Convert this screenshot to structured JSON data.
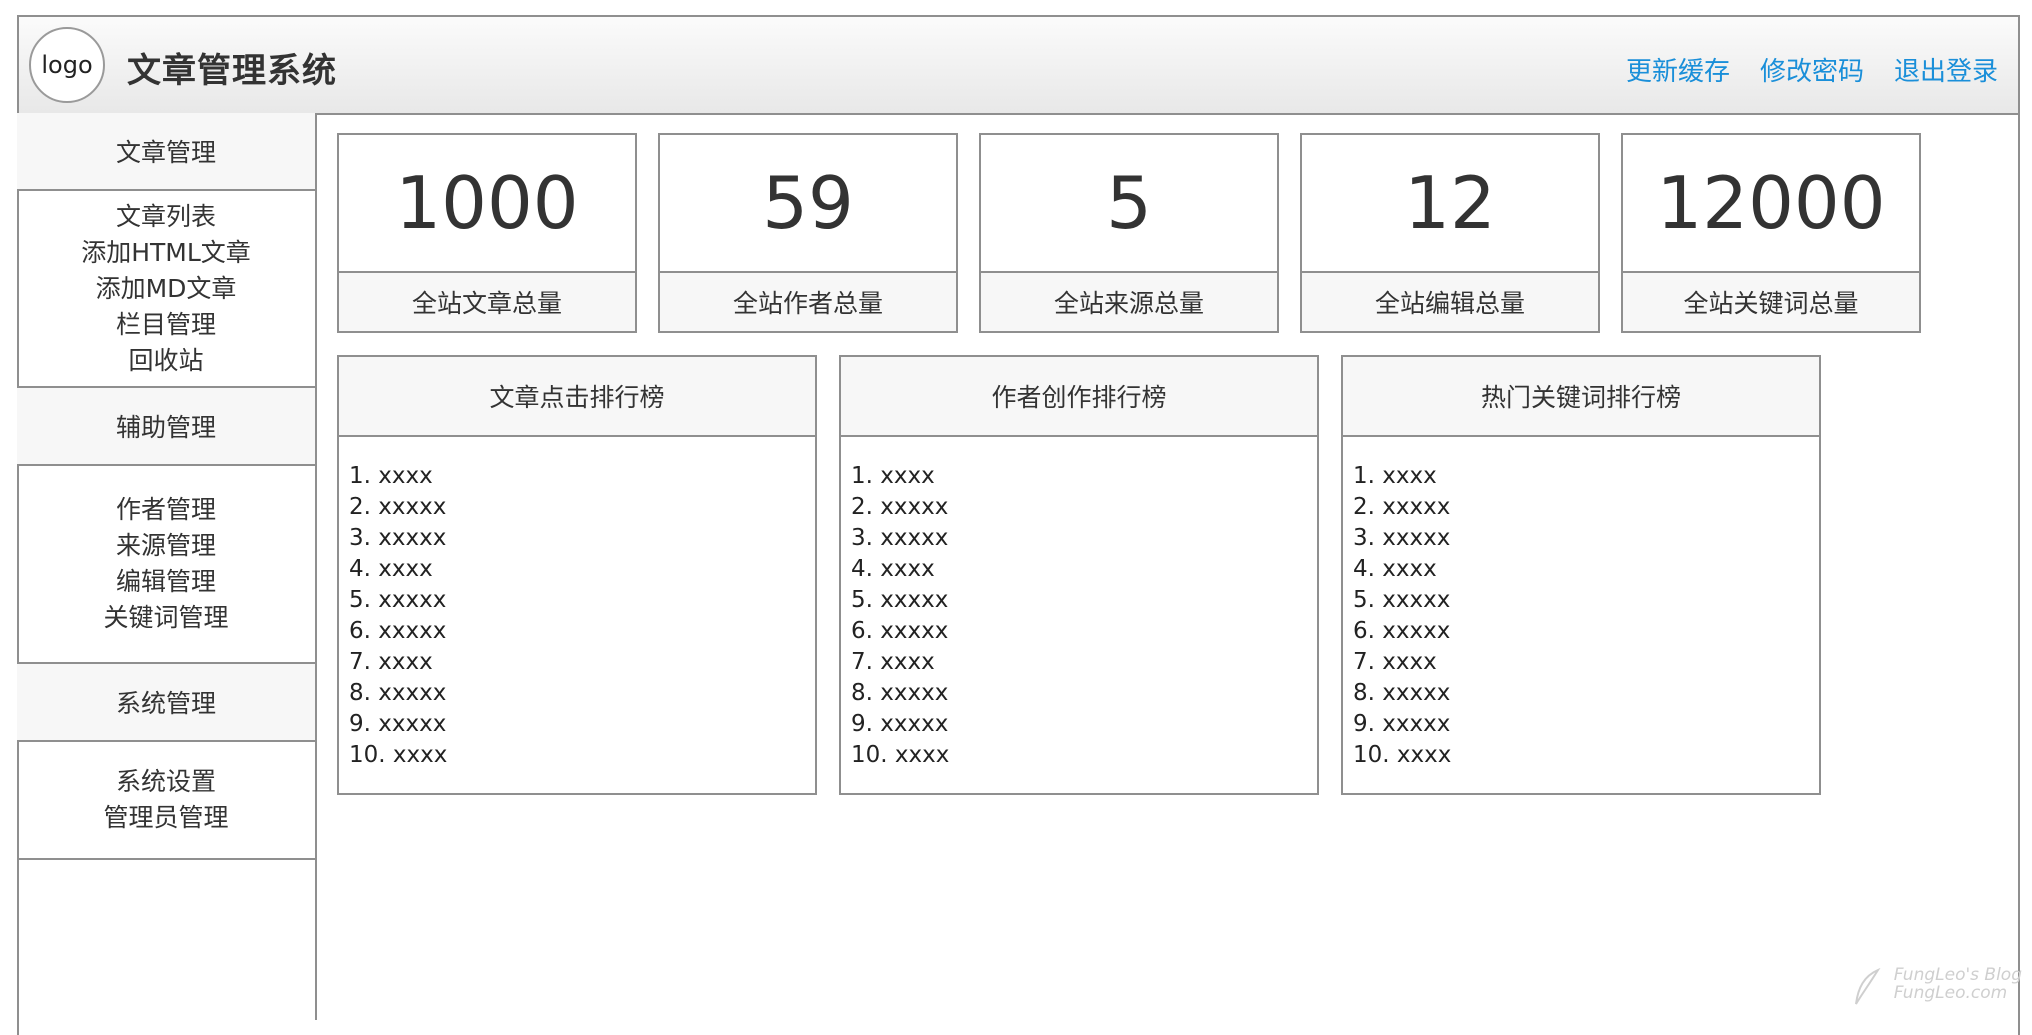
{
  "header": {
    "logo_text": "logo",
    "app_title": "文章管理系统",
    "actions": [
      "更新缓存",
      "修改密码",
      "退出登录"
    ]
  },
  "sidebar": {
    "groups": [
      {
        "title": "文章管理",
        "items": [
          "文章列表",
          "添加HTML文章",
          "添加MD文章",
          "栏目管理",
          "回收站"
        ]
      },
      {
        "title": "辅助管理",
        "items": [
          "作者管理",
          "来源管理",
          "编辑管理",
          "关键词管理"
        ]
      },
      {
        "title": "系统管理",
        "items": [
          "系统设置",
          "管理员管理"
        ]
      }
    ]
  },
  "stats": [
    {
      "value": "1000",
      "label": "全站文章总量"
    },
    {
      "value": "59",
      "label": "全站作者总量"
    },
    {
      "value": "5",
      "label": "全站来源总量"
    },
    {
      "value": "12",
      "label": "全站编辑总量"
    },
    {
      "value": "12000",
      "label": "全站关键词总量"
    }
  ],
  "rankings": [
    {
      "title": "文章点击排行榜",
      "items": [
        "1. xxxx",
        "2. xxxxx",
        "3. xxxxx",
        "4. xxxx",
        "5. xxxxx",
        "6. xxxxx",
        "7. xxxx",
        "8. xxxxx",
        "9. xxxxx",
        "10. xxxx"
      ]
    },
    {
      "title": "作者创作排行榜",
      "items": [
        "1. xxxx",
        "2. xxxxx",
        "3. xxxxx",
        "4. xxxx",
        "5. xxxxx",
        "6. xxxxx",
        "7. xxxx",
        "8. xxxxx",
        "9. xxxxx",
        "10. xxxx"
      ]
    },
    {
      "title": "热门关键词排行榜",
      "items": [
        "1. xxxx",
        "2. xxxxx",
        "3. xxxxx",
        "4. xxxx",
        "5. xxxxx",
        "6. xxxxx",
        "7. xxxx",
        "8. xxxxx",
        "9. xxxxx",
        "10. xxxx"
      ]
    }
  ],
  "watermark": {
    "line1": "FungLeo's Blog",
    "line2": "FungLeo.com"
  },
  "colors": {
    "link": "#1a8fd9",
    "border": "#8f8f8f",
    "panel_bg": "#f7f7f7"
  }
}
